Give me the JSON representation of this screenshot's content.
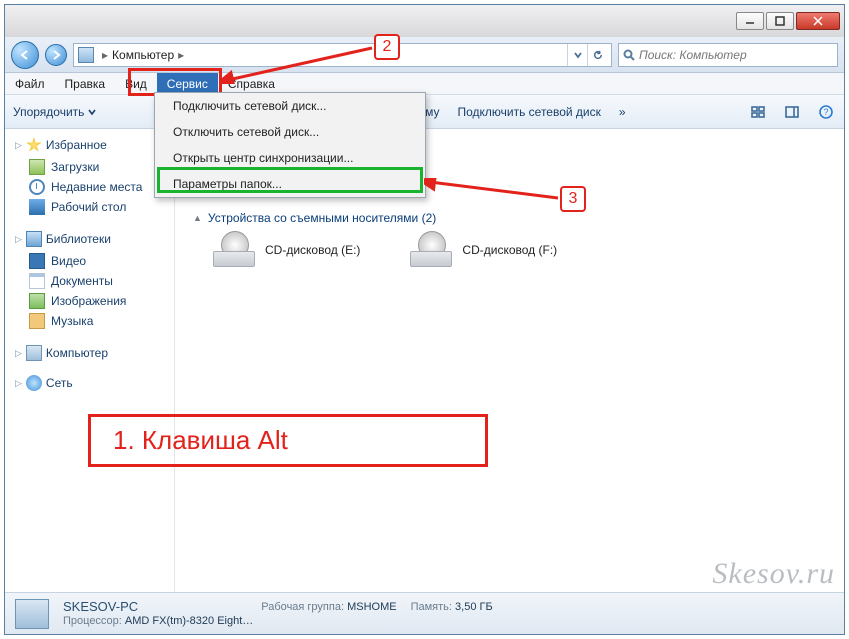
{
  "titlebar": {
    "min": "",
    "max": "",
    "close": ""
  },
  "nav": {
    "crumb_root": "",
    "crumb_computer": "Компьютер",
    "search_placeholder": "Поиск: Компьютер"
  },
  "menubar": {
    "file": "Файл",
    "edit": "Правка",
    "view": "Вид",
    "service": "Сервис",
    "help": "Справка"
  },
  "toolbar": {
    "organize": "Упорядочить",
    "truncated": "ограмму",
    "map_drive": "Подключить сетевой диск",
    "chev": "»"
  },
  "dropdown": {
    "map": "Подключить сетевой диск...",
    "unmap": "Отключить сетевой диск...",
    "sync": "Открыть центр синхронизации...",
    "folder_opts": "Параметры папок..."
  },
  "side": {
    "fav": "Избранное",
    "downloads": "Загрузки",
    "recent": "Недавние места",
    "desktop": "Рабочий стол",
    "libs": "Библиотеки",
    "video": "Видео",
    "docs": "Документы",
    "images": "Изображения",
    "music": "Музыка",
    "computer": "Компьютер",
    "network": "Сеть"
  },
  "content": {
    "removable_hdr": "Устройства со съемными носителями (2)",
    "drive_e": "CD-дисковод (E:)",
    "drive_f": "CD-дисковод (F:)"
  },
  "status": {
    "name": "SKESOV-PC",
    "wg_k": "Рабочая группа:",
    "wg_v": "MSHOME",
    "cpu_k": "Процессор:",
    "cpu_v": "AMD FX(tm)-8320 Eight…",
    "mem_k": "Память:",
    "mem_v": "3,50 ГБ"
  },
  "ann": {
    "n1": "1. Клавиша Alt",
    "n2": "2",
    "n3": "3"
  },
  "watermark": "Skesov.ru"
}
